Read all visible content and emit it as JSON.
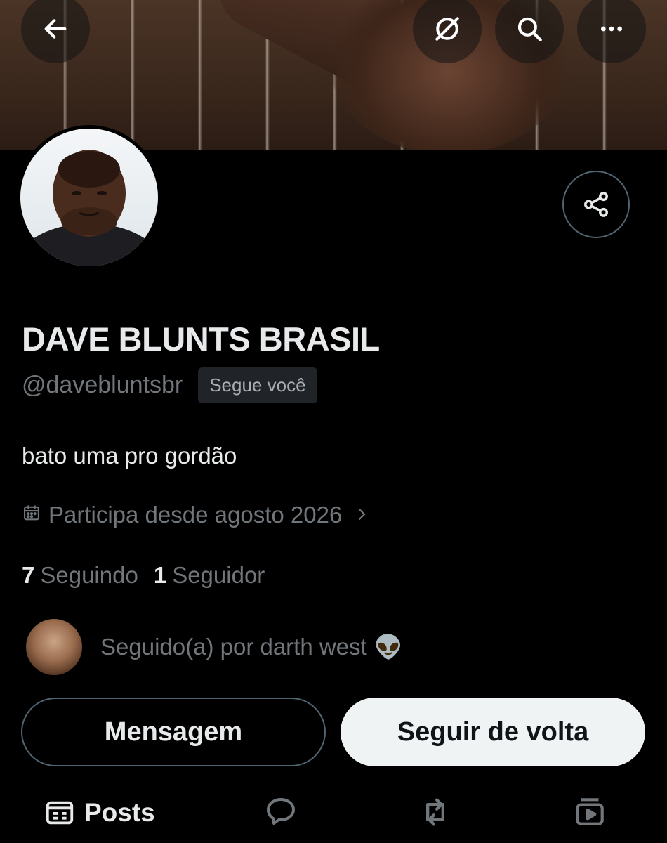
{
  "header": {
    "back_icon": "arrow-left-icon",
    "grok_icon": "grok-slash-icon",
    "search_icon": "search-icon",
    "more_icon": "more-horizontal-icon"
  },
  "profile": {
    "display_name": "DAVE BLUNTS BRASIL",
    "handle": "@davebluntsbr",
    "follows_you_badge": "Segue você",
    "bio": "bato uma pro gordão",
    "joined": "Participa desde agosto 2026",
    "following_count": "7",
    "following_label": "Seguindo",
    "followers_count": "1",
    "followers_label": "Seguidor",
    "followed_by": "Seguido(a) por darth west",
    "followed_by_emoji": "👽"
  },
  "actions": {
    "message_label": "Mensagem",
    "follow_back_label": "Seguir de volta"
  },
  "tabs": {
    "posts_label": "Posts"
  },
  "colors": {
    "background": "#000000",
    "text_primary": "#e7e9ea",
    "text_secondary": "#71767b",
    "border": "#536471",
    "follow_button_bg": "#eff3f4"
  }
}
